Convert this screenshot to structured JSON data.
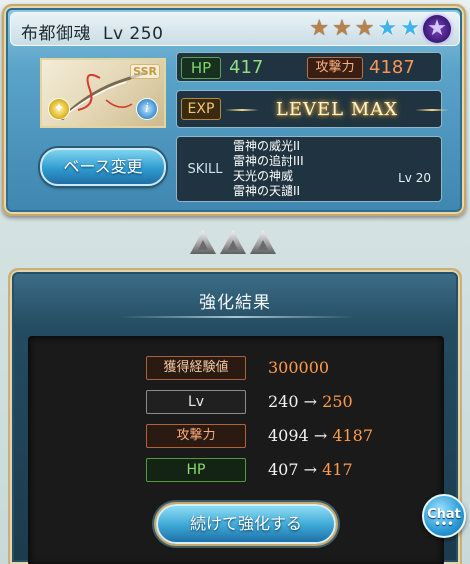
{
  "weapon": {
    "name": "布都御魂",
    "level_text": "Lv 250",
    "rarity_badge": "SSR",
    "stars": [
      "bronze",
      "bronze",
      "bronze",
      "blue",
      "blue",
      "violet"
    ],
    "hp_label": "HP",
    "hp_value": "417",
    "atk_label": "攻撃力",
    "atk_value": "4187",
    "exp_label": "EXP",
    "exp_status": "LEVEL MAX",
    "base_change_label": "ベース変更",
    "skill_label": "SKILL",
    "skills": [
      "雷神の威光II",
      "雷神の追討III",
      "天光の神威",
      "雷神の天譴II"
    ],
    "skill_level": "Lv 20"
  },
  "result": {
    "title": "強化結果",
    "exp_gain_label": "獲得経験値",
    "exp_gain_value": "300000",
    "lv_label": "Lv",
    "lv_before": "240",
    "lv_after": "250",
    "atk_label": "攻撃力",
    "atk_before": "4094",
    "atk_after": "4187",
    "hp_label": "HP",
    "hp_before": "407",
    "hp_after": "417",
    "arrow": "→",
    "continue_label": "続けて強化する"
  },
  "chat": {
    "label": "Chat",
    "dots": "•••"
  },
  "colors": {
    "accent_orange": "#ff9b4a",
    "hp_green": "#86db6d",
    "frame_gold": "#c8b07a",
    "button_blue": "#3ba7d6"
  }
}
